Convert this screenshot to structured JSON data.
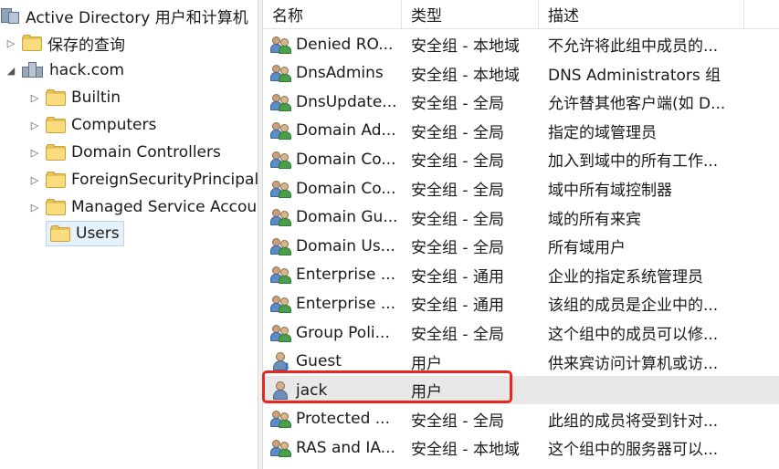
{
  "tree": {
    "root_label": "Active Directory 用户和计算机",
    "saved_queries_label": "保存的查询",
    "domain_label": "hack.com",
    "children": [
      {
        "label": "Builtin"
      },
      {
        "label": "Computers"
      },
      {
        "label": "Domain Controllers"
      },
      {
        "label": "ForeignSecurityPrincipals"
      },
      {
        "label": "Managed Service Accounts"
      },
      {
        "label": "Users"
      }
    ]
  },
  "list": {
    "columns": {
      "name": "名称",
      "type": "类型",
      "description": "描述"
    },
    "rows": [
      {
        "name": "Denied RO...",
        "type": "安全组 - 本地域",
        "description": "不允许将此组中成员的...",
        "icon": "group-icon"
      },
      {
        "name": "DnsAdmins",
        "type": "安全组 - 本地域",
        "description": "DNS Administrators 组",
        "icon": "group-icon"
      },
      {
        "name": "DnsUpdate...",
        "type": "安全组 - 全局",
        "description": "允许替其他客户端(如 D...",
        "icon": "group-icon"
      },
      {
        "name": "Domain Ad...",
        "type": "安全组 - 全局",
        "description": "指定的域管理员",
        "icon": "group-icon"
      },
      {
        "name": "Domain Co...",
        "type": "安全组 - 全局",
        "description": "加入到域中的所有工作...",
        "icon": "group-icon"
      },
      {
        "name": "Domain Co...",
        "type": "安全组 - 全局",
        "description": "域中所有域控制器",
        "icon": "group-icon"
      },
      {
        "name": "Domain Gu...",
        "type": "安全组 - 全局",
        "description": "域的所有来宾",
        "icon": "group-icon"
      },
      {
        "name": "Domain Us...",
        "type": "安全组 - 全局",
        "description": "所有域用户",
        "icon": "group-icon"
      },
      {
        "name": "Enterprise ...",
        "type": "安全组 - 通用",
        "description": "企业的指定系统管理员",
        "icon": "group-icon"
      },
      {
        "name": "Enterprise ...",
        "type": "安全组 - 通用",
        "description": "该组的成员是企业中的...",
        "icon": "group-icon"
      },
      {
        "name": "Group Poli...",
        "type": "安全组 - 全局",
        "description": "这个组中的成员可以修...",
        "icon": "group-icon"
      },
      {
        "name": "Guest",
        "type": "用户",
        "description": "供来宾访问计算机或访...",
        "icon": "user-disabled-icon"
      },
      {
        "name": "jack",
        "type": "用户",
        "description": "",
        "icon": "user-icon"
      },
      {
        "name": "Protected ...",
        "type": "安全组 - 全局",
        "description": "此组的成员将受到针对...",
        "icon": "group-icon"
      },
      {
        "name": "RAS and IA...",
        "type": "安全组 - 本地域",
        "description": "这个组中的服务器可以...",
        "icon": "group-icon"
      }
    ]
  },
  "colors": {
    "highlight_box": "#e8271f",
    "selected_bg": "#e5f1fb"
  }
}
